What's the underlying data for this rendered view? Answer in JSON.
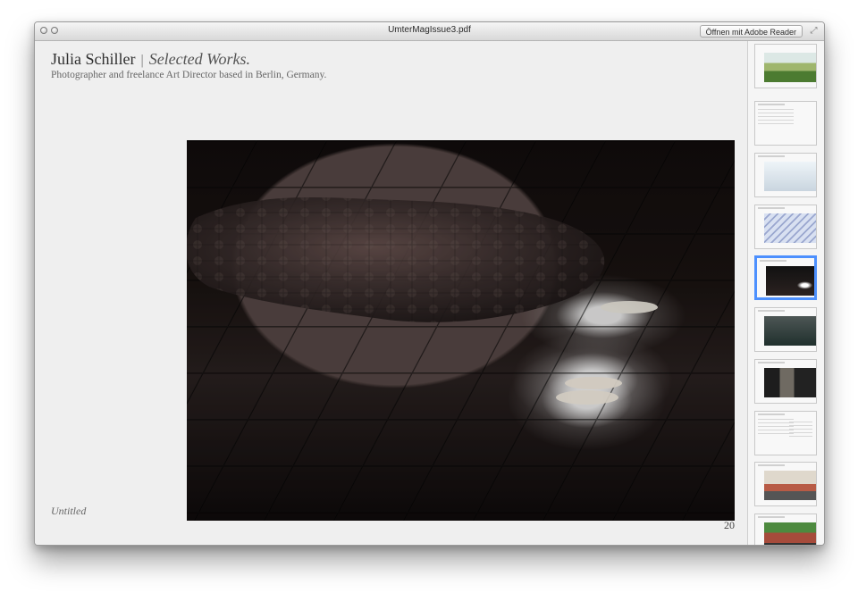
{
  "window": {
    "title": "UmterMagIssue3.pdf",
    "open_button": "Öffnen mit Adobe Reader"
  },
  "document": {
    "name": "Julia Schiller",
    "separator": "|",
    "subtitle": "Selected Works.",
    "description": "Photographer and freelance Art Director based in Berlin, Germany.",
    "caption": "Untitled",
    "page_number": "20"
  },
  "sidebar": {
    "thumbnails": [
      {
        "kind": "landscape",
        "selected": false
      },
      {
        "kind": "text",
        "selected": false
      },
      {
        "kind": "sky",
        "selected": false
      },
      {
        "kind": "person",
        "selected": false
      },
      {
        "kind": "dark-floor",
        "selected": true
      },
      {
        "kind": "dark-landscape",
        "selected": false
      },
      {
        "kind": "street",
        "selected": false
      },
      {
        "kind": "text-columns",
        "selected": false
      },
      {
        "kind": "truck",
        "selected": false
      },
      {
        "kind": "truck",
        "selected": false
      }
    ]
  },
  "colors": {
    "selection": "#4d90fe",
    "page_background": "#efefef"
  },
  "icons": {
    "close": "close-icon",
    "minimize": "minimize-icon",
    "fullscreen": "fullscreen-icon"
  }
}
